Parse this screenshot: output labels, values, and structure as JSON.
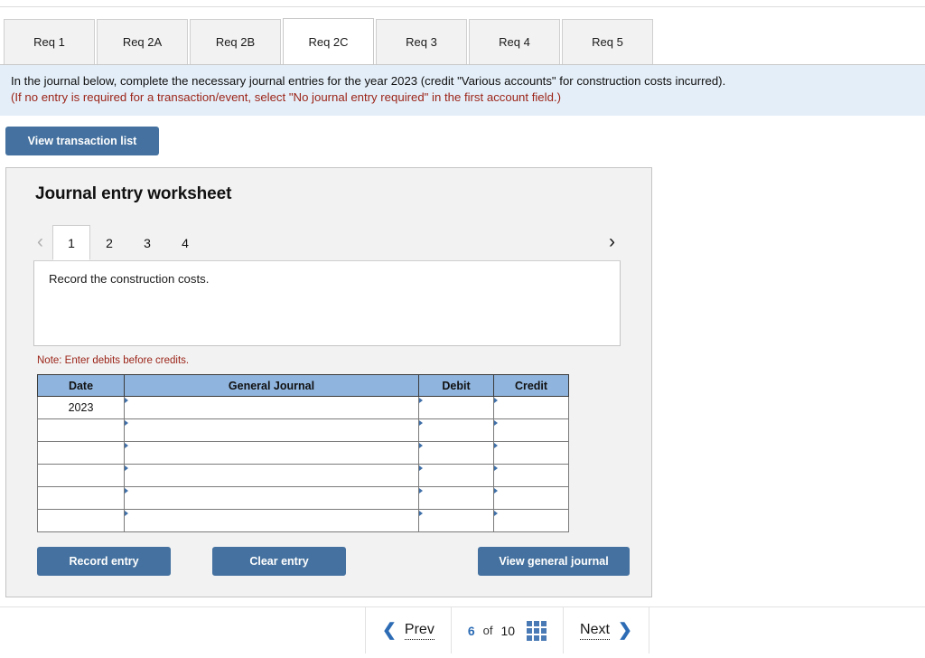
{
  "req_tabs": [
    {
      "label": "Req 1",
      "active": false
    },
    {
      "label": "Req 2A",
      "active": false
    },
    {
      "label": "Req 2B",
      "active": false
    },
    {
      "label": "Req 2C",
      "active": true
    },
    {
      "label": "Req 3",
      "active": false
    },
    {
      "label": "Req 4",
      "active": false
    },
    {
      "label": "Req 5",
      "active": false
    }
  ],
  "instructions": {
    "line1": "In the journal below, complete the necessary journal entries for the year 2023 (credit \"Various accounts\" for construction costs incurred).",
    "line2": "(If no entry is required for a transaction/event, select \"No journal entry required\" in the first account field.)"
  },
  "toolbar": {
    "view_transaction_list": "View transaction list"
  },
  "worksheet": {
    "title": "Journal entry worksheet",
    "prev_chevron": "‹",
    "next_chevron": "›",
    "entry_tabs": [
      "1",
      "2",
      "3",
      "4"
    ],
    "active_entry": "1",
    "description": "Record the construction costs.",
    "note": "Note: Enter debits before credits.",
    "table": {
      "headers": [
        "Date",
        "General Journal",
        "Debit",
        "Credit"
      ],
      "rows": [
        {
          "date": "2023",
          "journal": "",
          "debit": "",
          "credit": ""
        },
        {
          "date": "",
          "journal": "",
          "debit": "",
          "credit": ""
        },
        {
          "date": "",
          "journal": "",
          "debit": "",
          "credit": ""
        },
        {
          "date": "",
          "journal": "",
          "debit": "",
          "credit": ""
        },
        {
          "date": "",
          "journal": "",
          "debit": "",
          "credit": ""
        },
        {
          "date": "",
          "journal": "",
          "debit": "",
          "credit": ""
        }
      ]
    },
    "actions": {
      "record_entry": "Record entry",
      "clear_entry": "Clear entry",
      "view_general_journal": "View general journal"
    }
  },
  "footer": {
    "prev_chevron": "❮",
    "prev_label": "Prev",
    "current_page": "6",
    "of_label": "of",
    "total_pages": "10",
    "grid_icon": "grid-icon",
    "next_label": "Next",
    "next_chevron": "❯"
  },
  "colors": {
    "accent_blue": "#44719f",
    "table_header_blue": "#8fb4dd",
    "input_border_blue": "#5b87bb",
    "banner_blue": "#e4eef8",
    "warning_red": "#9b2418",
    "link_blue": "#2d6cb5"
  }
}
